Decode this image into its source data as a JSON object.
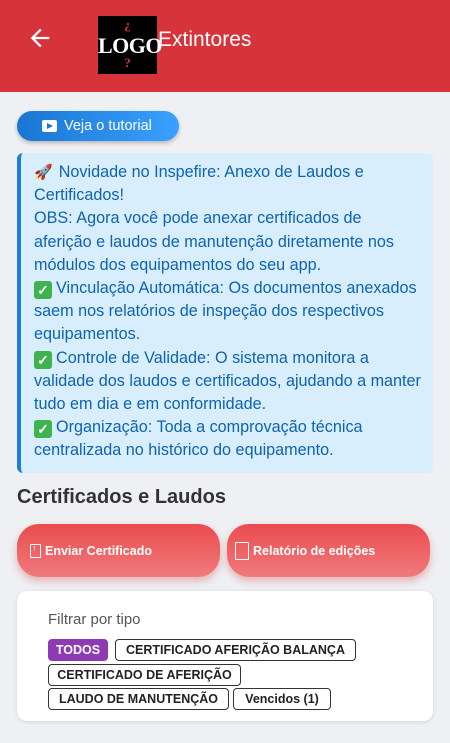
{
  "appbar": {
    "title": "Extintores",
    "logo": {
      "top": "¿",
      "word": "LOGO",
      "bottom": "?"
    }
  },
  "tutorial": {
    "label": "Veja o tutorial"
  },
  "notice": {
    "lines": [
      "Novidade no Inspefire: Anexo de Laudos e Certificados!",
      "OBS: Agora você pode anexar certificados de aferição e laudos de manutenção diretamente nos módulos dos equipamentos do seu app.",
      "Vinculação Automática: Os documentos anexados saem nos relatórios de inspeção dos respectivos equipamentos.",
      "Controle de Validade: O sistema monitora a validade dos laudos e certificados, ajudando a manter tudo em dia e em conformidade.",
      "Organização: Toda a comprovação técnica centralizada no histórico do equipamento."
    ]
  },
  "section": {
    "title": "Certificados e Laudos"
  },
  "buttons": {
    "send": "Enviar Certificado",
    "report": "Relatório de edições"
  },
  "filter": {
    "label": "Filtrar por tipo",
    "chips": [
      "TODOS",
      "CERTIFICADO AFERIÇÃO BALANÇA",
      "CERTIFICADO DE AFERIÇÃO",
      "LAUDO DE MANUTENÇÃO",
      "Vencidos (1)"
    ],
    "selected": "TODOS"
  },
  "colors": {
    "appbar": "#d6333a",
    "accent_blue": "#1976d2",
    "chip_active": "#8e3bb3",
    "check": "#3fb34f"
  }
}
